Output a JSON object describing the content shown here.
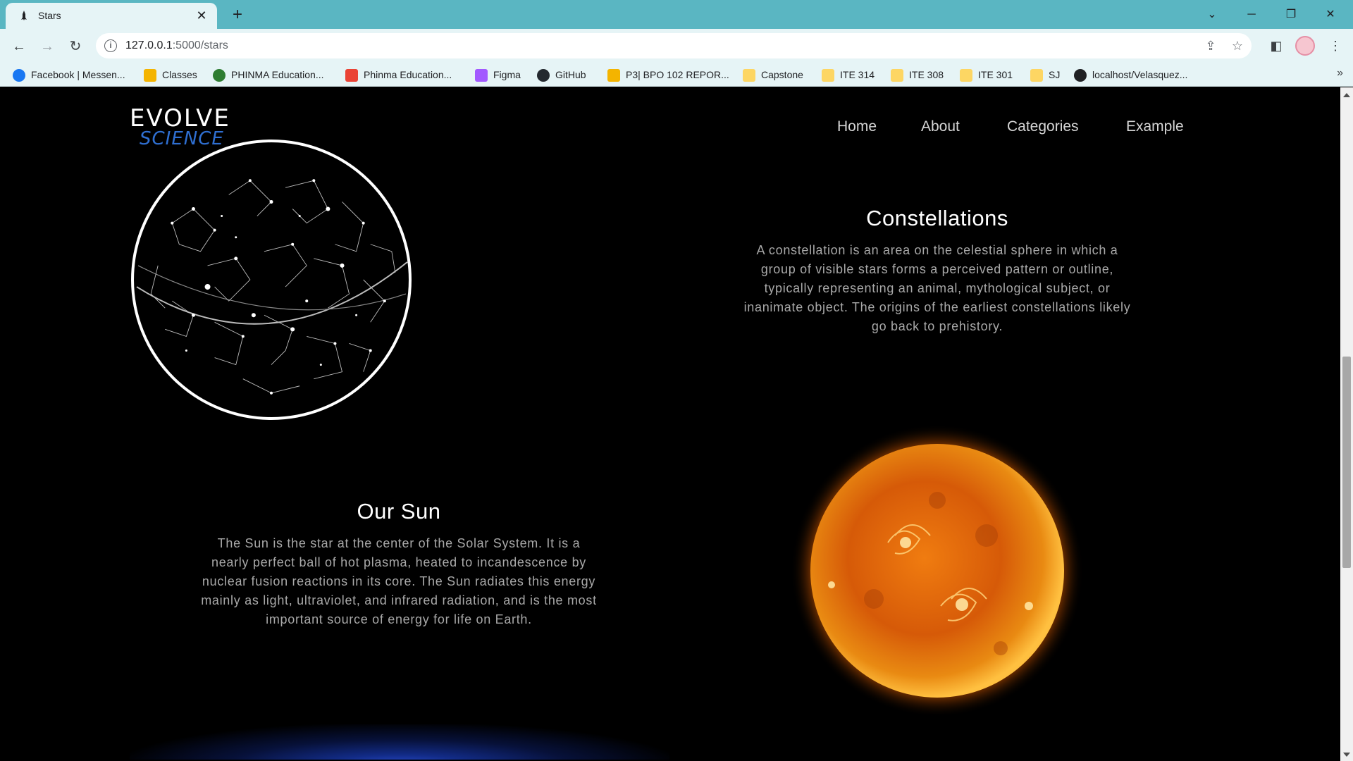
{
  "browser": {
    "tab_title": "Stars",
    "url_host": "127.0.0.1",
    "url_path": ":5000/stars",
    "bookmarks": [
      {
        "label": "Facebook | Messen...",
        "icon": "facebook-icon",
        "color": "#1877f2"
      },
      {
        "label": "Classes",
        "icon": "classroom-icon",
        "color": "#f4b400"
      },
      {
        "label": "PHINMA Education...",
        "icon": "globe-icon",
        "color": "#2e7d32"
      },
      {
        "label": "Phinma Education...",
        "icon": "gmail-icon",
        "color": "#ea4335"
      },
      {
        "label": "Figma",
        "icon": "figma-icon",
        "color": "#a259ff"
      },
      {
        "label": "GitHub",
        "icon": "github-icon",
        "color": "#24292f"
      },
      {
        "label": "P3| BPO 102 REPOR...",
        "icon": "slides-icon",
        "color": "#f4b400"
      },
      {
        "label": "Capstone",
        "icon": "folder-icon",
        "color": "#fdd663"
      },
      {
        "label": "ITE 314",
        "icon": "folder-icon",
        "color": "#fdd663"
      },
      {
        "label": "ITE 308",
        "icon": "folder-icon",
        "color": "#fdd663"
      },
      {
        "label": "ITE 301",
        "icon": "folder-icon",
        "color": "#fdd663"
      },
      {
        "label": "SJ",
        "icon": "folder-icon",
        "color": "#fdd663"
      },
      {
        "label": "localhost/Velasquez...",
        "icon": "globe-icon",
        "color": "#202124"
      }
    ]
  },
  "site": {
    "logo_top": "EVOLVE",
    "logo_bottom": "SCIENCE",
    "nav": [
      "Home",
      "About",
      "Categories",
      "Example"
    ]
  },
  "constellations": {
    "title": "Constellations",
    "text": "A constellation is an area on the celestial sphere in which a group of visible stars forms a perceived pattern or outline, typically representing an animal, mythological subject, or inanimate object. The origins of the earliest constellations likely go back to prehistory."
  },
  "sun": {
    "title": "Our Sun",
    "text": "The Sun is the star at the center of the Solar System. It is a nearly perfect ball of hot plasma, heated to incandescence by nuclear fusion reactions in its core. The Sun radiates this energy mainly as light, ultraviolet, and infrared radiation, and is the most important source of energy for life on Earth."
  },
  "colors": {
    "browser_accent": "#5ab6c2",
    "page_background": "#000000",
    "nav_text": "#d6d6d6",
    "body_text": "#a8a8a8"
  }
}
